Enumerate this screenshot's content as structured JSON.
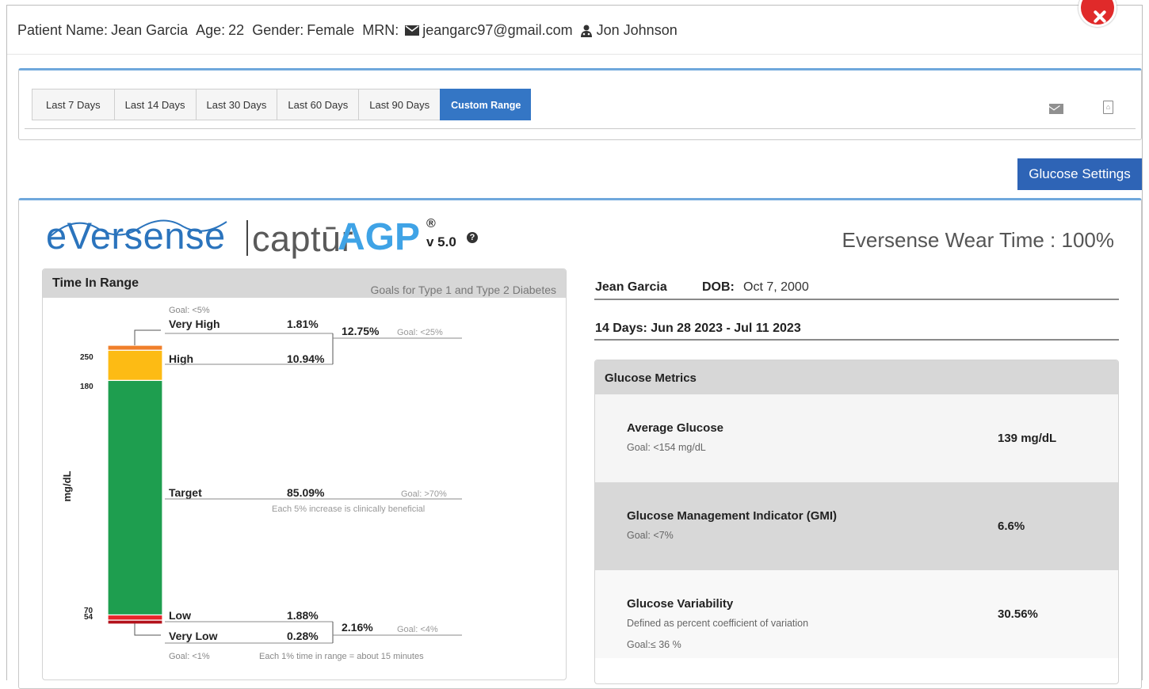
{
  "patient": {
    "name_label": "Patient Name:",
    "name": "Jean Garcia",
    "age_label": "Age:",
    "age": "22",
    "gender_label": "Gender:",
    "gender": "Female",
    "mrn_label": "MRN:",
    "email": "jeangarc97@gmail.com",
    "clinician": "Jon Johnson"
  },
  "range_tabs": [
    {
      "label": "Last 7 Days",
      "active": false
    },
    {
      "label": "Last 14 Days",
      "active": false
    },
    {
      "label": "Last 30 Days",
      "active": false
    },
    {
      "label": "Last 60 Days",
      "active": false
    },
    {
      "label": "Last 90 Days",
      "active": false
    },
    {
      "label": "Custom Range",
      "active": true
    }
  ],
  "glucose_settings_label": "Glucose Settings",
  "logo": {
    "brand": "eVersense",
    "product_a": "captūr",
    "product_b": "AGP",
    "reg": "®",
    "version": "v 5.0"
  },
  "wear_time": "Eversense Wear Time : 100%",
  "tir": {
    "title": "Time In Range",
    "goals_note": "Goals for Type 1 and Type 2 Diabetes",
    "axis_label": "mg/dL",
    "thresholds": [
      "250",
      "180",
      "70",
      "54"
    ],
    "very_high_goal": "Goal: <5%",
    "very_high_label": "Very High",
    "very_high_pct": "1.81%",
    "high_label": "High",
    "high_pct": "10.94%",
    "high_combined_pct": "12.75%",
    "high_combined_goal": "Goal: <25%",
    "target_label": "Target",
    "target_pct": "85.09%",
    "target_goal": "Goal: >70%",
    "target_note": "Each 5% increase is clinically beneficial",
    "low_label": "Low",
    "low_pct": "1.88%",
    "very_low_label": "Very Low",
    "very_low_pct": "0.28%",
    "low_combined_pct": "2.16%",
    "low_combined_goal": "Goal: <4%",
    "very_low_goal": "Goal: <1%",
    "minutes_note": "Each 1% time in range = about 15 minutes",
    "segments": [
      {
        "name": "Very High",
        "pct": 1.81,
        "color": "#f07f2a"
      },
      {
        "name": "High",
        "pct": 10.94,
        "color": "#fdbb14"
      },
      {
        "name": "Target",
        "pct": 85.09,
        "color": "#1e9e4f"
      },
      {
        "name": "Low",
        "pct": 1.88,
        "color": "#e8262b"
      },
      {
        "name": "Very Low",
        "pct": 0.28,
        "color": "#b3121b"
      }
    ]
  },
  "details": {
    "name": "Jean Garcia",
    "dob_label": "DOB:",
    "dob": "Oct 7, 2000",
    "range": "14 Days: Jun 28 2023 - Jul 11 2023"
  },
  "metrics": {
    "title": "Glucose Metrics",
    "rows": [
      {
        "name": "Average Glucose",
        "goal": "Goal: <154 mg/dL",
        "value": "139 mg/dL"
      },
      {
        "name": "Glucose Management Indicator (GMI)",
        "goal": "Goal: <7%",
        "value": "6.6%"
      },
      {
        "name": "Glucose Variability",
        "desc": "Defined as percent coefficient of variation",
        "goal": "Goal:≤ 36 %",
        "value": "30.56%"
      }
    ]
  },
  "colors": {
    "accent": "#2e64b6",
    "tab_active": "#3476c5",
    "close": "#e02a2a",
    "logo_blue": "#2b74bd",
    "agp_blue": "#3fa3e6"
  },
  "icons": [
    "envelope-icon",
    "user-md-icon",
    "close-circle-icon",
    "email-report-icon",
    "pdf-icon",
    "help-icon"
  ]
}
